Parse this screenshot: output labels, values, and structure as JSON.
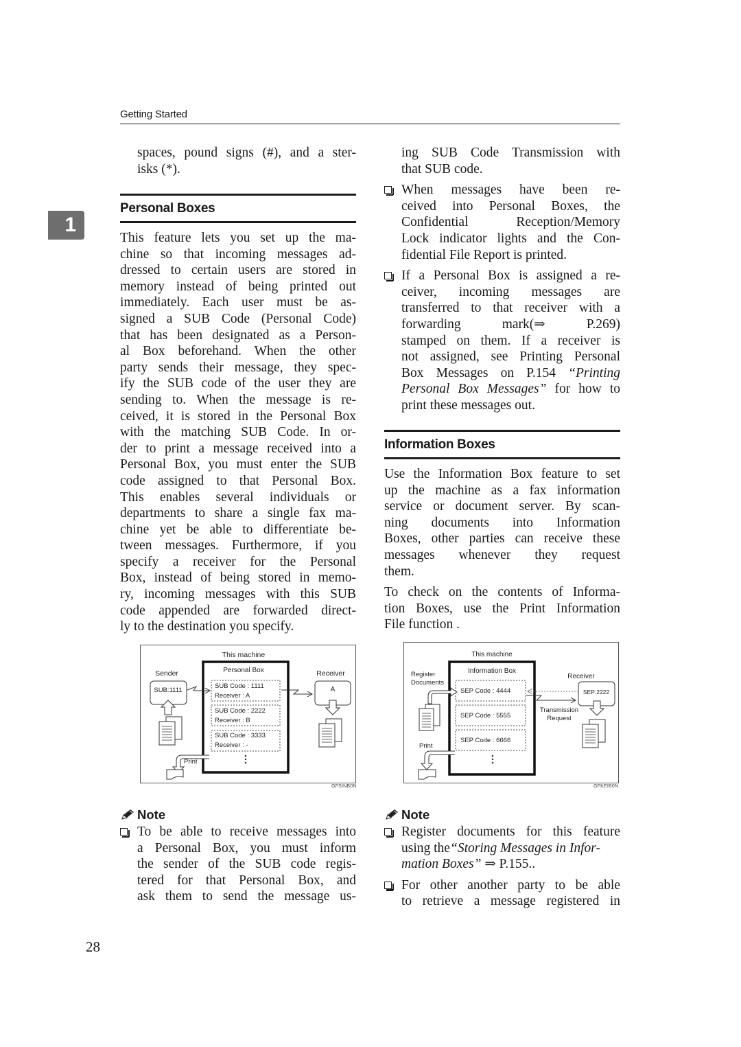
{
  "header": {
    "section": "Getting Started"
  },
  "chapter_tab": "1",
  "page_number": "28",
  "left_column": {
    "intro_lines": [
      "spaces, pound signs (#), and a ster-",
      "isks (*)."
    ],
    "personal_boxes": {
      "heading": "Personal Boxes",
      "body_lines": [
        "This feature lets you set up the ma-",
        "chine so that incoming messages ad-",
        "dressed to certain users are stored in",
        "memory instead of being printed out",
        "immediately. Each user must be as-",
        "signed a SUB Code (Personal Code)",
        "that has been designated as a Person-",
        "al Box beforehand. When the other",
        "party sends their message, they spec-",
        "ify the SUB code of the user they are",
        "sending to. When the message is re-",
        "ceived, it is stored in the Personal Box",
        "with the matching SUB Code.  In or-",
        "der to print a message received into a",
        "Personal Box, you must enter the SUB",
        "code assigned to that Personal Box.",
        "This enables several individuals or",
        "departments to share a single fax ma-",
        "chine yet be able to differentiate be-",
        "tween messages. Furthermore, if you",
        "specify a receiver for the Personal",
        "Box, instead of being stored in memo-",
        "ry, incoming messages with this SUB",
        "code appended are forwarded direct-",
        "ly to the destination you specify."
      ]
    },
    "figure": {
      "title": "This machine",
      "box_label": "Personal Box",
      "sender_label": "Sender",
      "sender_code": "SUB:1111",
      "receiver_label": "Receiver",
      "receiver_code": "A",
      "entries": [
        {
          "code": "SUB Code : 1111",
          "receiver": "Receiver : A"
        },
        {
          "code": "SUB Code : 2222",
          "receiver": "Receiver : B"
        },
        {
          "code": "SUB Code : 3333",
          "receiver": "Receiver : -"
        }
      ],
      "print_label": "Print",
      "figure_id": "GFSINB0N"
    },
    "note": {
      "label": "Note",
      "items": [
        {
          "lines": [
            "To be able to receive messages into",
            "a Personal Box, you must inform",
            "the sender of the SUB code regis-",
            "tered for that Personal Box, and",
            "ask them to send the message us-"
          ]
        }
      ]
    }
  },
  "right_column": {
    "continuation_lines": [
      "ing SUB Code Transmission with",
      "that SUB code."
    ],
    "bullets": [
      {
        "lines": [
          "When messages have been re-",
          "ceived into Personal Boxes, the",
          "Confidential Reception/Memory",
          "Lock indicator lights and the Con-",
          "fidential File Report is printed."
        ]
      },
      {
        "lines": [
          "If a Personal Box is assigned a re-",
          "ceiver, incoming messages are",
          "transferred to that receiver with a",
          "forwarding mark(⇒ P.269)",
          "stamped on them. If a receiver is",
          "not assigned, see Printing Personal"
        ],
        "line7_plain": "Box Messages on P.154 ",
        "line7_italic": "“Printing",
        "line8_italic": "Personal Box Messages”",
        "line8_plain": " for how to",
        "line9": "print these messages out."
      }
    ],
    "information_boxes": {
      "heading": "Information Boxes",
      "para1_lines": [
        "Use the Information Box feature to set",
        "up the machine as a fax information",
        "service or document server. By scan-",
        "ning documents into Information",
        "Boxes, other parties can receive these",
        "messages whenever they request",
        "them."
      ],
      "para2_lines": [
        "To check on the contents of Informa-",
        "tion Boxes, use the Print Information",
        "File function ."
      ]
    },
    "figure": {
      "title": "This machine",
      "box_label": "Information Box",
      "register_label_1": "Register",
      "register_label_2": "Documents",
      "receiver_label": "Receiver",
      "receiver_code": "SEP:2222",
      "request_label_1": "Transmission",
      "request_label_2": "Request",
      "entries": [
        "SEP Code : 4444",
        "SEP Code : 5555",
        "SEP Code : 6666"
      ],
      "print_label": "Print",
      "figure_id": "GFKEIB0N"
    },
    "note": {
      "label": "Note",
      "item1_line1": "Register documents for this feature",
      "item1_line2_plain": "using the",
      "item1_line2_italic": "“Storing Messages in Infor-",
      "item1_line3_italic": "mation Boxes”",
      "item1_line3_plain": " ⇒ P.155..",
      "item2_lines": [
        "For other another party to be able",
        "to retrieve a message registered in"
      ]
    }
  }
}
